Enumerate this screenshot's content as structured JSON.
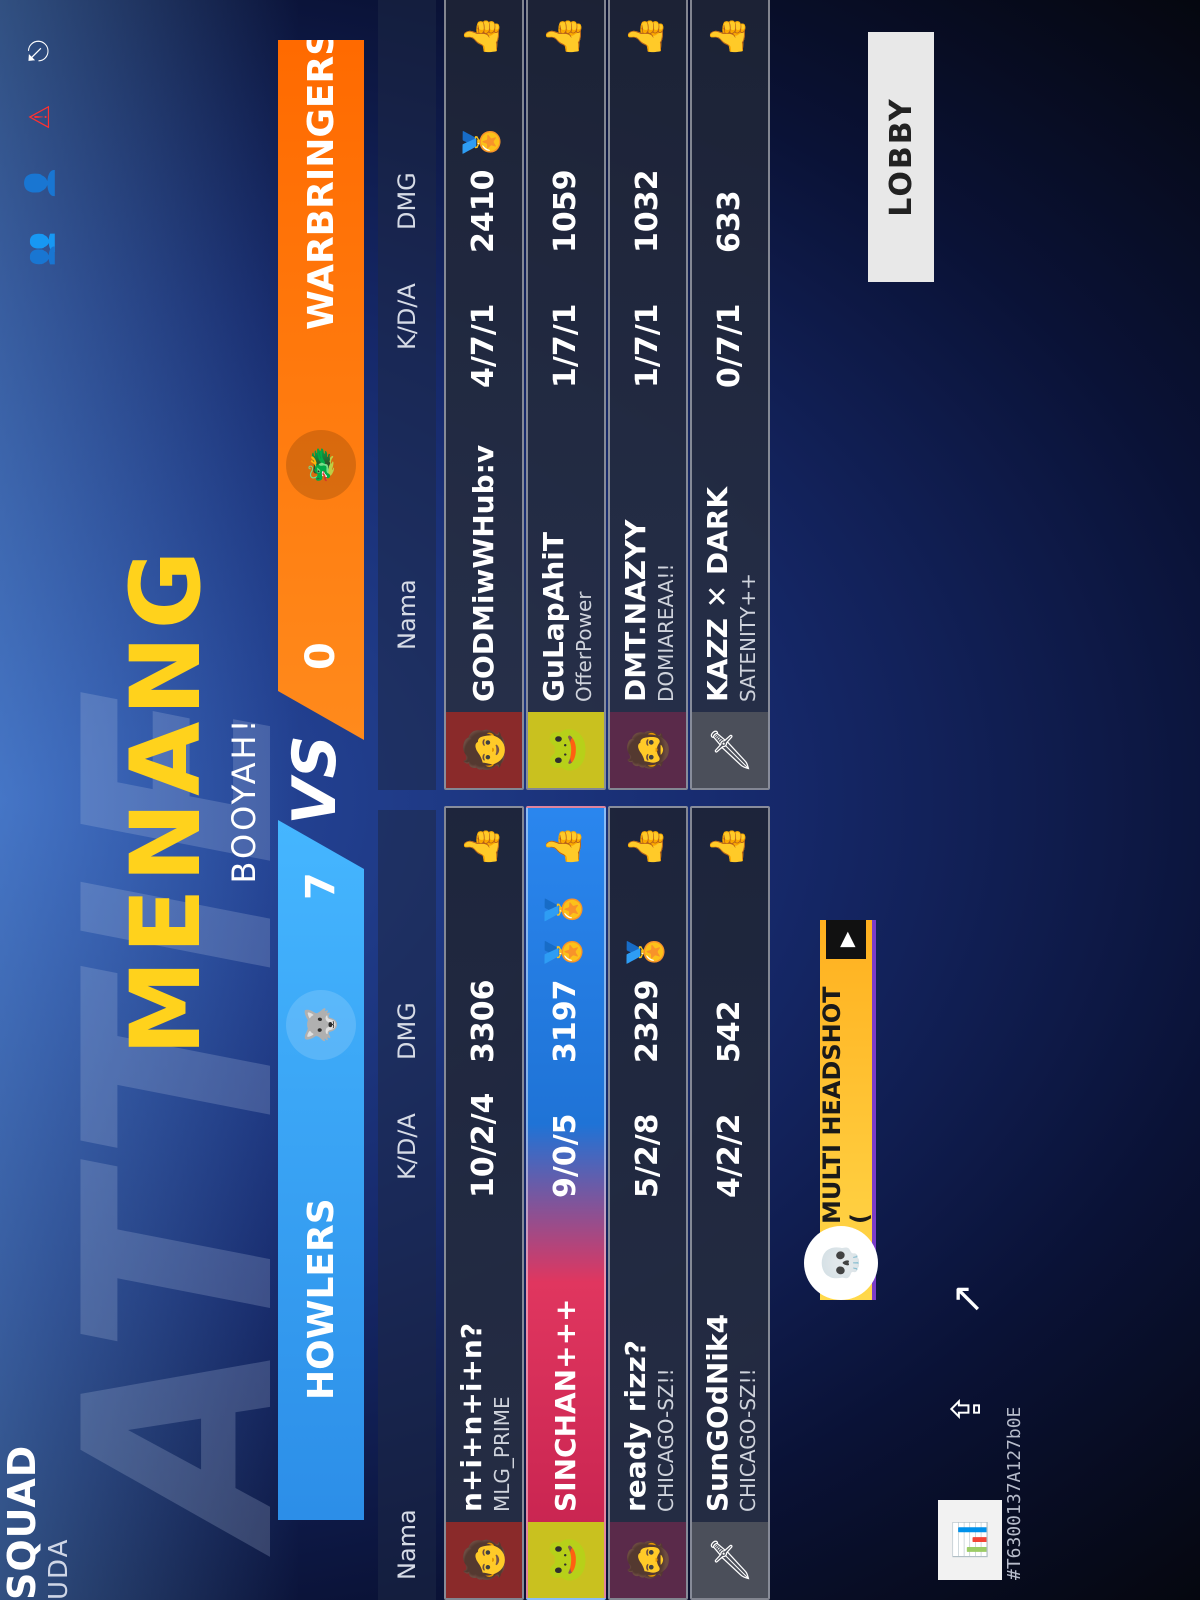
{
  "header": {
    "mode_title": "SQUAD",
    "mode_subtitle": "UDA",
    "icons": [
      "profile-icon",
      "add-friend-icon",
      "report-icon",
      "exit-icon"
    ]
  },
  "result": {
    "title": "MENANG",
    "subtitle": "BOOYAH!"
  },
  "teams": {
    "left": {
      "name": "HOWLERS",
      "score": "7",
      "color": "#3aa6f5"
    },
    "vs": "VS",
    "right": {
      "name": "WARBRINGERS",
      "score": "0",
      "color": "#ff7a10"
    }
  },
  "columns": {
    "name": "Nama",
    "kda": "K/D/A",
    "dmg": "DMG"
  },
  "left_players": [
    {
      "name": "n+i+n+i+n?",
      "guild": "MLG_PRIME",
      "kda": "10/2/4",
      "dmg": "3306",
      "medals": "",
      "highlight": false
    },
    {
      "name": "SINCHAN+++",
      "guild": "",
      "kda": "9/0/5",
      "dmg": "3197",
      "medals": "🏅🏅",
      "highlight": true
    },
    {
      "name": "ready rizz?",
      "guild": "CHICAGO-SZ!!",
      "kda": "5/2/8",
      "dmg": "2329",
      "medals": "🏅",
      "highlight": false
    },
    {
      "name": "SunGOdNik4",
      "guild": "CHICAGO-SZ!!",
      "kda": "4/2/2",
      "dmg": "542",
      "medals": "",
      "highlight": false
    }
  ],
  "right_players": [
    {
      "name": "GODMiwWHub:v",
      "guild": "",
      "kda": "4/7/1",
      "dmg": "2410",
      "medals": "🏅"
    },
    {
      "name": "GuLapAhiT",
      "guild": "OfferPower",
      "kda": "1/7/1",
      "dmg": "1059",
      "medals": ""
    },
    {
      "name": "DMT.NAZYY",
      "guild": "DOMIAREAA!!",
      "kda": "1/7/1",
      "dmg": "1032",
      "medals": ""
    },
    {
      "name": "KAZZ ✕ DARK",
      "guild": "SATENITY++",
      "kda": "0/7/1",
      "dmg": "633",
      "medals": ""
    }
  ],
  "banner": {
    "label": "MULTI HEADSHOT (",
    "icon": "skull-icon"
  },
  "footer": {
    "match_id": "#T6300137A127b0E",
    "lobby_label": "LOBBY",
    "stats_icon": "bar-chart-icon",
    "save_icon": "upload-icon",
    "share_icon": "share-icon"
  }
}
